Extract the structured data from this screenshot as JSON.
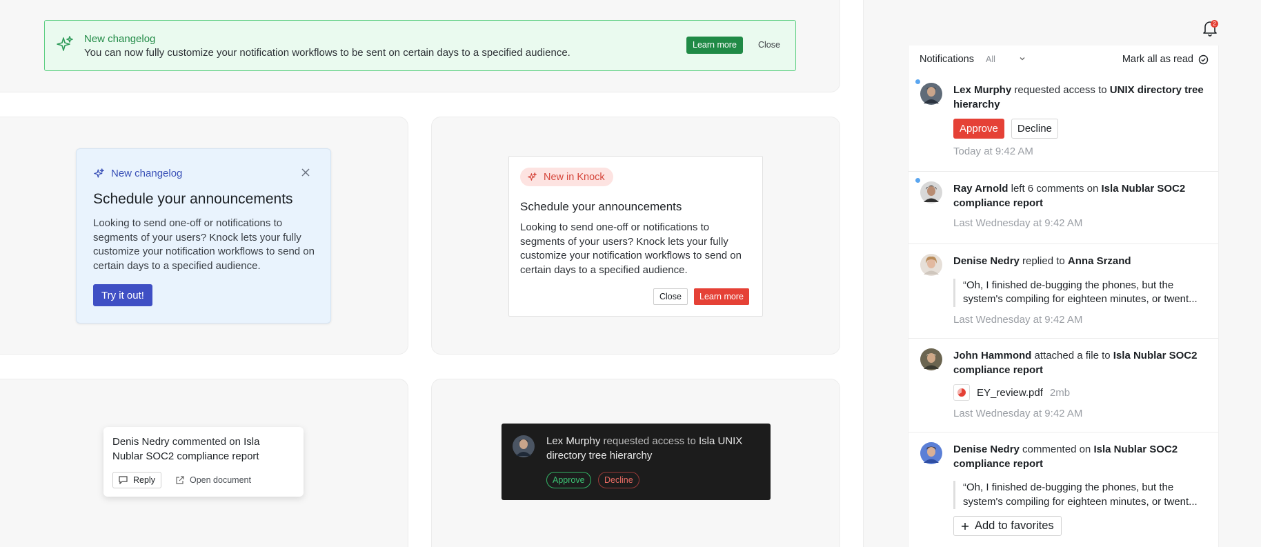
{
  "banner": {
    "title": "New changelog",
    "description": "You can now fully customize your notification workflows to be sent on certain days to a specified audience.",
    "learn_more": "Learn more",
    "close": "Close",
    "accent": "#208a46"
  },
  "blue_card": {
    "tag": "New changelog",
    "title": "Schedule your announcements",
    "body": "Looking to send one-off or notifications to segments of your users? Knock lets your fully customize your notification workflows to send on certain days to a specified audience.",
    "cta": "Try it out!",
    "accent": "#3f4fc4"
  },
  "knock_card": {
    "tag": "New in Knock",
    "title": "Schedule your announcements",
    "body": "Looking to send one-off or notifications to segments of your users? Knock lets your fully customize your notification workflows to send on certain days to a specified audience.",
    "close": "Close",
    "learn_more": "Learn more",
    "accent": "#e54136"
  },
  "comment_card": {
    "actor": "Denis Nedry",
    "verb": " commented on ",
    "target": "Isla Nublar SOC2 compliance report",
    "reply": "Reply",
    "open_document": "Open document"
  },
  "dark_card": {
    "actor": "Lex Murphy",
    "verb": " requested access to ",
    "target": "Isla UNIX directory tree hierarchy",
    "approve": "Approve",
    "decline": "Decline"
  },
  "bell": {
    "count": "2"
  },
  "feed": {
    "title": "Notifications",
    "filter": "All",
    "mark_all": "Mark all as read",
    "items": [
      {
        "actor": "Lex Murphy",
        "verb": " requested access to ",
        "target": "UNIX directory tree hierarchy",
        "approve": "Approve",
        "decline": "Decline",
        "time": "Today at 9:42 AM"
      },
      {
        "actor": "Ray Arnold",
        "verb": " left 6 comments on ",
        "target": "Isla Nublar SOC2 compliance report",
        "time": "Last Wednesday at 9:42 AM"
      },
      {
        "actor": "Denise Nedry",
        "verb": " replied to ",
        "target": "Anna Srzand",
        "quote_line1": "“Oh, I finished de-bugging the phones, but the",
        "quote_line2": "system's compiling for eighteen minutes, or twent...",
        "time": "Last Wednesday at 9:42 AM"
      },
      {
        "actor": "John Hammond",
        "verb": " attached a file to ",
        "target": "Isla Nublar SOC2 compliance report",
        "file_name": "EY_review.pdf",
        "file_size": "2mb",
        "time": "Last Wednesday at 9:42 AM"
      },
      {
        "actor": "Denise Nedry",
        "verb": " commented on ",
        "target": "Isla Nublar SOC2 compliance report",
        "quote_line1": "“Oh, I finished de-bugging the phones, but the",
        "quote_line2": "system's compiling for eighteen minutes, or twent...",
        "favorites": "Add to favorites"
      }
    ]
  }
}
